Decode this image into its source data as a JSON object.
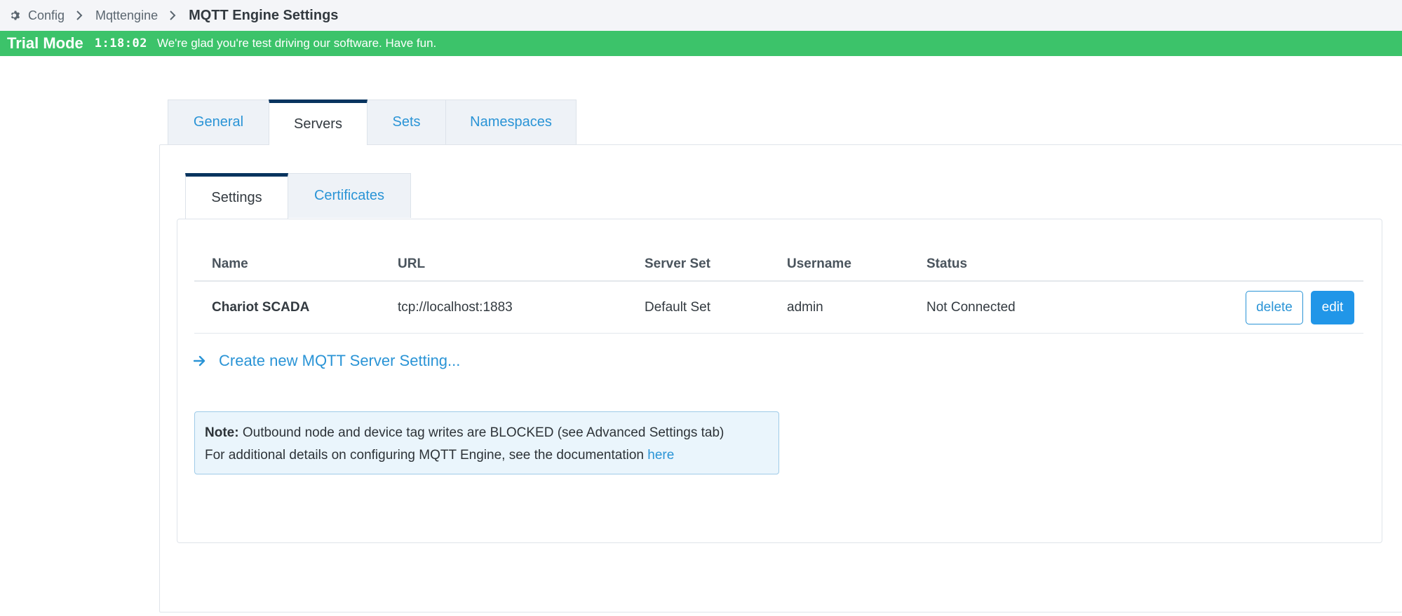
{
  "breadcrumb": {
    "items": [
      "Config",
      "Mqttengine"
    ],
    "current": "MQTT Engine Settings",
    "icon": "gear-icon"
  },
  "trial_banner": {
    "title": "Trial Mode",
    "timer": "1:18:02",
    "message": "We're glad you're test driving our software. Have fun.",
    "background_color": "#3cc36a"
  },
  "top_tabs": {
    "items": [
      "General",
      "Servers",
      "Sets",
      "Namespaces"
    ],
    "active": "Servers"
  },
  "sub_tabs": {
    "items": [
      "Settings",
      "Certificates"
    ],
    "active": "Settings"
  },
  "server_table": {
    "columns": [
      "Name",
      "URL",
      "Server Set",
      "Username",
      "Status"
    ],
    "rows": [
      {
        "name": "Chariot SCADA",
        "url": "tcp://localhost:1883",
        "server_set": "Default Set",
        "username": "admin",
        "status": "Not Connected",
        "delete_label": "delete",
        "edit_label": "edit"
      }
    ]
  },
  "create_link": {
    "label": "Create new MQTT Server Setting...",
    "icon": "arrow-right-icon"
  },
  "note": {
    "label": "Note:",
    "line1": "Outbound node and device tag writes are BLOCKED (see Advanced Settings tab)",
    "line2": "For additional details on configuring MQTT Engine, see the documentation",
    "link_label": "here"
  },
  "colors": {
    "accent": "#2a94d6",
    "active_tab_border": "#07345f",
    "primary_button": "#2196e8"
  }
}
